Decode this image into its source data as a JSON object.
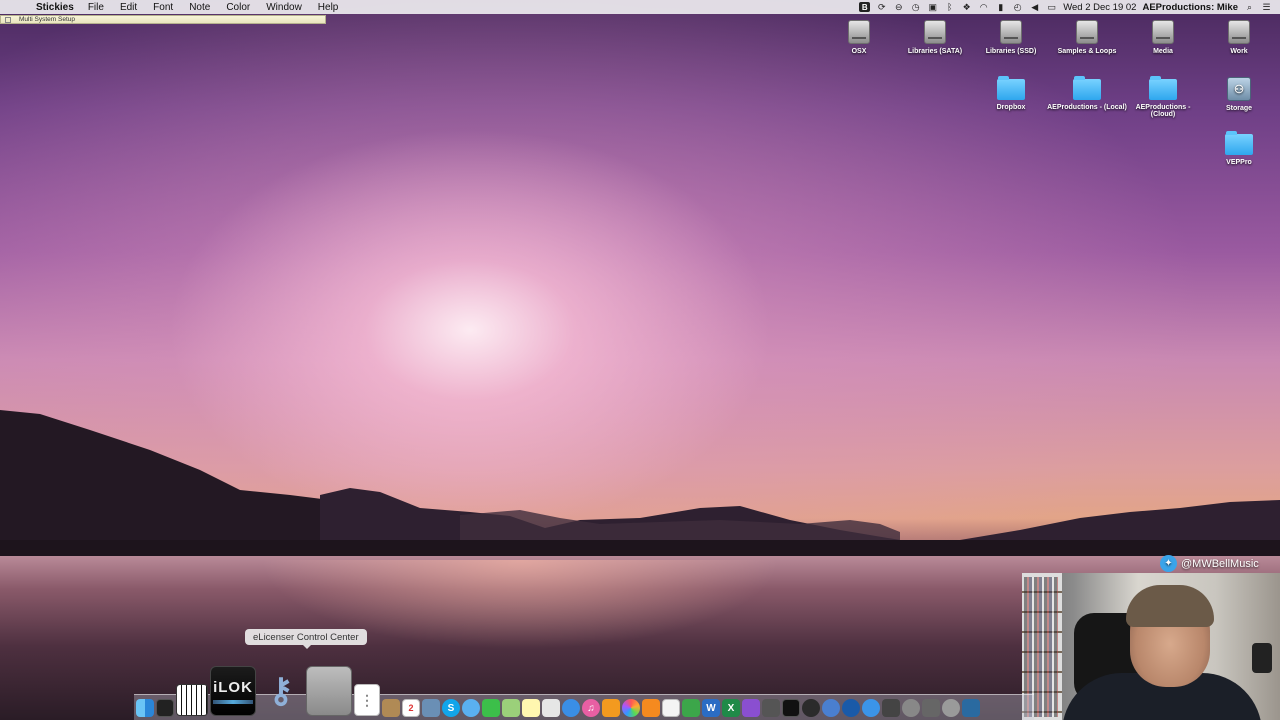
{
  "menubar": {
    "app_name": "Stickies",
    "menus": [
      "File",
      "Edit",
      "Font",
      "Note",
      "Color",
      "Window",
      "Help"
    ],
    "status_box_label": "B",
    "datetime": "Wed 2 Dec  19 02",
    "user": "AEProductions: Mike"
  },
  "sticky_window": {
    "title": "Multi System Setup"
  },
  "desktop_icons": [
    {
      "label": "OSX",
      "type": "drive"
    },
    {
      "label": "Libraries (SATA)",
      "type": "drive"
    },
    {
      "label": "Libraries (SSD)",
      "type": "drive"
    },
    {
      "label": "Samples & Loops",
      "type": "drive"
    },
    {
      "label": "Media",
      "type": "drive"
    },
    {
      "label": "Work",
      "type": "drive"
    },
    {
      "label": "Dropbox",
      "type": "folder"
    },
    {
      "label": "AEProductions - (Local)",
      "type": "folder"
    },
    {
      "label": "AEProductions - (Cloud)",
      "type": "folder"
    },
    {
      "label": "Storage",
      "type": "network-storage"
    },
    {
      "label": "VEPPro",
      "type": "folder"
    }
  ],
  "twitter": {
    "handle": "@MWBellMusic"
  },
  "tooltip": {
    "text": "eLicenser Control Center"
  },
  "dock": {
    "ilok_label": "iLOK",
    "apps": [
      "finder-icon",
      "activity-monitor-icon",
      "piano-keyboard-icon",
      "ilok-license-manager-icon",
      "elicenser-keys-icon",
      "calculator-icon",
      "reminders-icon",
      "notefile-icon",
      "calendar-icon",
      "preview-icon",
      "skype-icon",
      "messages-icon",
      "facetime-icon",
      "maps-icon",
      "notes-icon",
      "photos-icon",
      "safari-icon",
      "itunes-icon",
      "ibooks-icon",
      "photos-app-icon",
      "vlc-icon",
      "textedit-icon",
      "numbers-icon",
      "word-icon",
      "excel-icon",
      "photo-booth-icon",
      "imovie-icon",
      "terminal-icon",
      "logic-icon",
      "vienna-icon",
      "quicktime-icon",
      "app-store-icon",
      "network-icon",
      "disk-utility-icon",
      "vep-icon",
      "system-preferences-icon",
      "trash-icon"
    ]
  },
  "colors": {
    "folder_blue": "#2ea7ee",
    "twitter_blue": "#3aa4ea",
    "menubar": "#eceaee"
  }
}
